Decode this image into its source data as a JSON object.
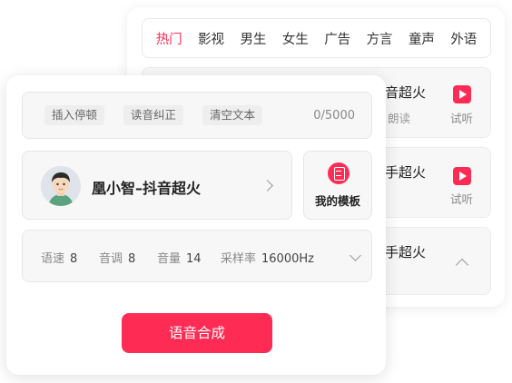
{
  "categories": [
    "热门",
    "影视",
    "男生",
    "女生",
    "广告",
    "方言",
    "童声",
    "外语"
  ],
  "voice_list": [
    {
      "title": "音超火",
      "sub": "朗读",
      "action": "试听"
    },
    {
      "title": "手超火",
      "sub": "",
      "action": "试听"
    },
    {
      "title": "手超火",
      "sub": "",
      "action": ""
    }
  ],
  "tools": {
    "insert_pause": "插入停顿",
    "pronunciation": "读音纠正",
    "clear_text": "清空文本",
    "counter": "0/5000"
  },
  "voice": {
    "name": "凰小智–抖音超火"
  },
  "template": {
    "label": "我的模板"
  },
  "params": {
    "speed_label": "语速",
    "speed_value": "8",
    "pitch_label": "音调",
    "pitch_value": "8",
    "volume_label": "音量",
    "volume_value": "14",
    "rate_label": "采样率",
    "rate_value": "16000Hz"
  },
  "synthesize_button": "语音合成",
  "colors": {
    "accent": "#fe2c55",
    "panel": "#f7f7f8"
  }
}
